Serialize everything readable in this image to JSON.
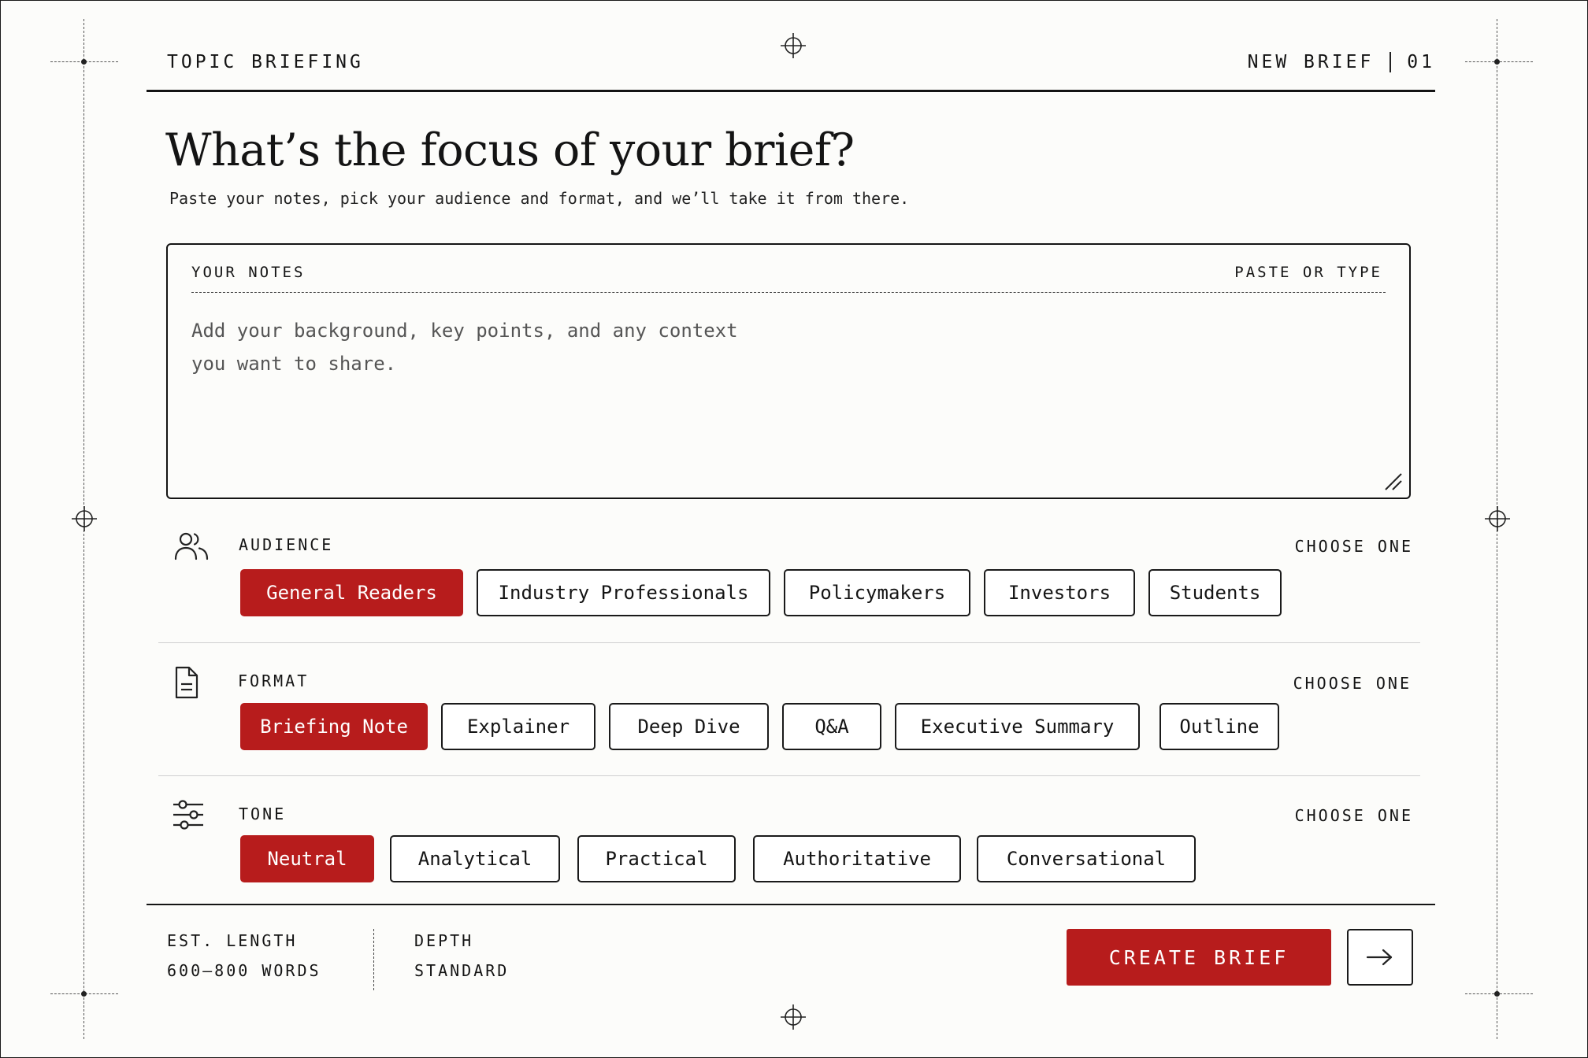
{
  "header": {
    "app_title": "TOPIC BRIEFING",
    "context": "NEW BRIEF",
    "step": "01"
  },
  "hero": {
    "title": "What’s the focus of your brief?",
    "subtitle": "Paste your notes, pick your audience and format, and we’ll take it from there."
  },
  "notes": {
    "label": "YOUR NOTES",
    "hint": "PASTE OR TYPE",
    "placeholder": "Add your background, key points, and any context\nyou want to share.",
    "value": ""
  },
  "audience": {
    "label": "AUDIENCE",
    "hint": "CHOOSE ONE",
    "icon": "users-icon",
    "options": [
      "General Readers",
      "Industry Professionals",
      "Policymakers",
      "Investors",
      "Students"
    ],
    "selected": "General Readers"
  },
  "format": {
    "label": "FORMAT",
    "hint": "CHOOSE ONE",
    "icon": "document-icon",
    "options": [
      "Briefing Note",
      "Explainer",
      "Deep Dive",
      "Q&A",
      "Executive Summary",
      "Outline"
    ],
    "selected": "Briefing Note"
  },
  "tone": {
    "label": "TONE",
    "hint": "CHOOSE ONE",
    "icon": "sliders-icon",
    "options": [
      "Neutral",
      "Analytical",
      "Practical",
      "Authoritative",
      "Conversational"
    ],
    "selected": "Neutral"
  },
  "footer": {
    "length_label": "EST. LENGTH",
    "length_value": "600–800 WORDS",
    "depth_label": "DEPTH",
    "depth_value": "STANDARD",
    "create_label": "CREATE BRIEF",
    "next_icon": "arrow-right-icon"
  },
  "colors": {
    "accent": "#b71c1c",
    "ink": "#141414",
    "paper": "#fcfcfa"
  }
}
